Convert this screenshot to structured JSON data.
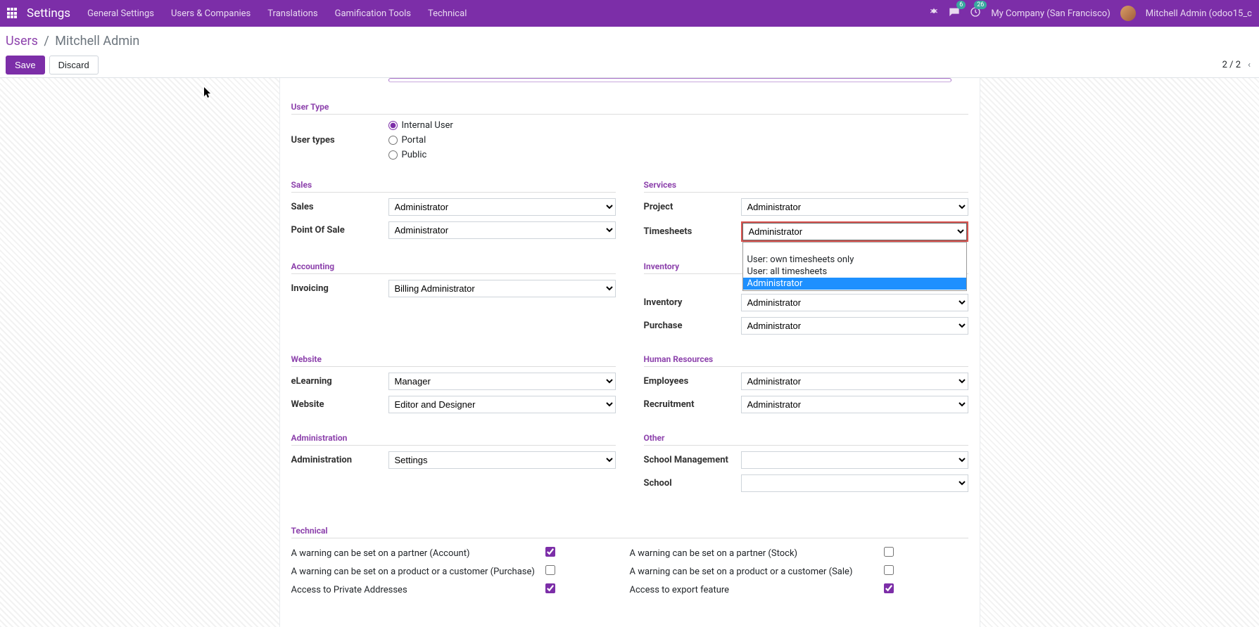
{
  "topbar": {
    "app_title": "Settings",
    "menu": [
      "General Settings",
      "Users & Companies",
      "Translations",
      "Gamification Tools",
      "Technical"
    ],
    "msg_badge": "6",
    "activity_badge": "26",
    "company": "My Company (San Francisco)",
    "user": "Mitchell Admin (odoo15_c"
  },
  "breadcrumb": {
    "parent": "Users",
    "current": "Mitchell Admin"
  },
  "actions": {
    "save": "Save",
    "discard": "Discard",
    "paging": "2 / 2"
  },
  "form": {
    "user_type_heading": "User Type",
    "user_types_label": "User types",
    "user_type_options": [
      "Internal User",
      "Portal",
      "Public"
    ],
    "sections": {
      "sales": {
        "title": "Sales",
        "fields": {
          "sales": {
            "label": "Sales",
            "value": "Administrator"
          },
          "pos": {
            "label": "Point Of Sale",
            "value": "Administrator"
          }
        }
      },
      "services": {
        "title": "Services",
        "fields": {
          "project": {
            "label": "Project",
            "value": "Administrator"
          },
          "timesheets": {
            "label": "Timesheets",
            "value": "Administrator",
            "options": [
              "",
              "User: own timesheets only",
              "User: all timesheets",
              "Administrator"
            ]
          }
        }
      },
      "accounting": {
        "title": "Accounting",
        "fields": {
          "invoicing": {
            "label": "Invoicing",
            "value": "Billing Administrator"
          }
        }
      },
      "inventory": {
        "title": "Inventory",
        "fields": {
          "inventory": {
            "label": "Inventory",
            "value": "Administrator"
          },
          "purchase": {
            "label": "Purchase",
            "value": "Administrator"
          }
        }
      },
      "website": {
        "title": "Website",
        "fields": {
          "elearning": {
            "label": "eLearning",
            "value": "Manager"
          },
          "website": {
            "label": "Website",
            "value": "Editor and Designer"
          }
        }
      },
      "hr": {
        "title": "Human Resources",
        "fields": {
          "employees": {
            "label": "Employees",
            "value": "Administrator"
          },
          "recruitment": {
            "label": "Recruitment",
            "value": "Administrator"
          }
        }
      },
      "admin": {
        "title": "Administration",
        "fields": {
          "administration": {
            "label": "Administration",
            "value": "Settings"
          }
        }
      },
      "other": {
        "title": "Other",
        "fields": {
          "school_mgmt": {
            "label": "School Management",
            "value": ""
          },
          "school": {
            "label": "School",
            "value": ""
          }
        }
      },
      "technical": {
        "title": "Technical",
        "rows": [
          {
            "left_label": "A warning can be set on a partner (Account)",
            "left_checked": true,
            "right_label": "A warning can be set on a partner (Stock)",
            "right_checked": false
          },
          {
            "left_label": "A warning can be set on a product or a customer (Purchase)",
            "left_checked": false,
            "right_label": "A warning can be set on a product or a customer (Sale)",
            "right_checked": false
          },
          {
            "left_label": "Access to Private Addresses",
            "left_checked": true,
            "right_label": "Access to export feature",
            "right_checked": true
          }
        ]
      }
    }
  }
}
